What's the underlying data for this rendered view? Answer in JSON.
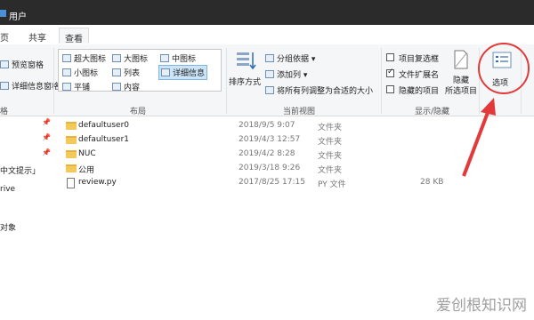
{
  "window": {
    "title": "用户"
  },
  "tabs": [
    {
      "label": "页"
    },
    {
      "label": "共享"
    },
    {
      "label": "查看"
    }
  ],
  "ribbon": {
    "pane_group": {
      "preview_pane": "预览窗格",
      "details_pane": "详细信息窗格",
      "label": "格"
    },
    "layout_group": {
      "extra_large": "超大图标",
      "large": "大图标",
      "medium": "中图标",
      "small": "小图标",
      "list": "列表",
      "details": "详细信息",
      "tiles": "平铺",
      "content": "内容",
      "label": "布局"
    },
    "view_group": {
      "sort_by": "排序方式",
      "group_by": "分组依据",
      "add_column": "添加列",
      "size_all_columns": "将所有列调整为合适的大小",
      "label": "当前视图"
    },
    "showhide_group": {
      "item_checkboxes": "项目复选框",
      "item_checkboxes_checked": false,
      "file_extensions": "文件扩展名",
      "file_extensions_checked": true,
      "hidden_items": "隐藏的项目",
      "hidden_items_checked": false,
      "hide_selected_1": "隐藏",
      "hide_selected_2": "所选项目",
      "label": "显示/隐藏"
    },
    "options": {
      "label": "选项"
    }
  },
  "navpane": {
    "items": [
      "中文提示」",
      "rive",
      "对象"
    ]
  },
  "files": [
    {
      "name": "defaultuser0",
      "date": "2018/9/5 9:07",
      "type": "文件夹",
      "size": "",
      "kind": "folder"
    },
    {
      "name": "defaultuser1",
      "date": "2019/4/3 12:57",
      "type": "文件夹",
      "size": "",
      "kind": "folder"
    },
    {
      "name": "NUC",
      "date": "2019/4/2 8:28",
      "type": "文件夹",
      "size": "",
      "kind": "folder"
    },
    {
      "name": "公用",
      "date": "2019/3/18 9:26",
      "type": "文件夹",
      "size": "",
      "kind": "folder"
    },
    {
      "name": "review.py",
      "date": "2017/8/25 17:15",
      "type": "PY 文件",
      "size": "28 KB",
      "kind": "file"
    }
  ],
  "watermark": "爱创根知识网"
}
